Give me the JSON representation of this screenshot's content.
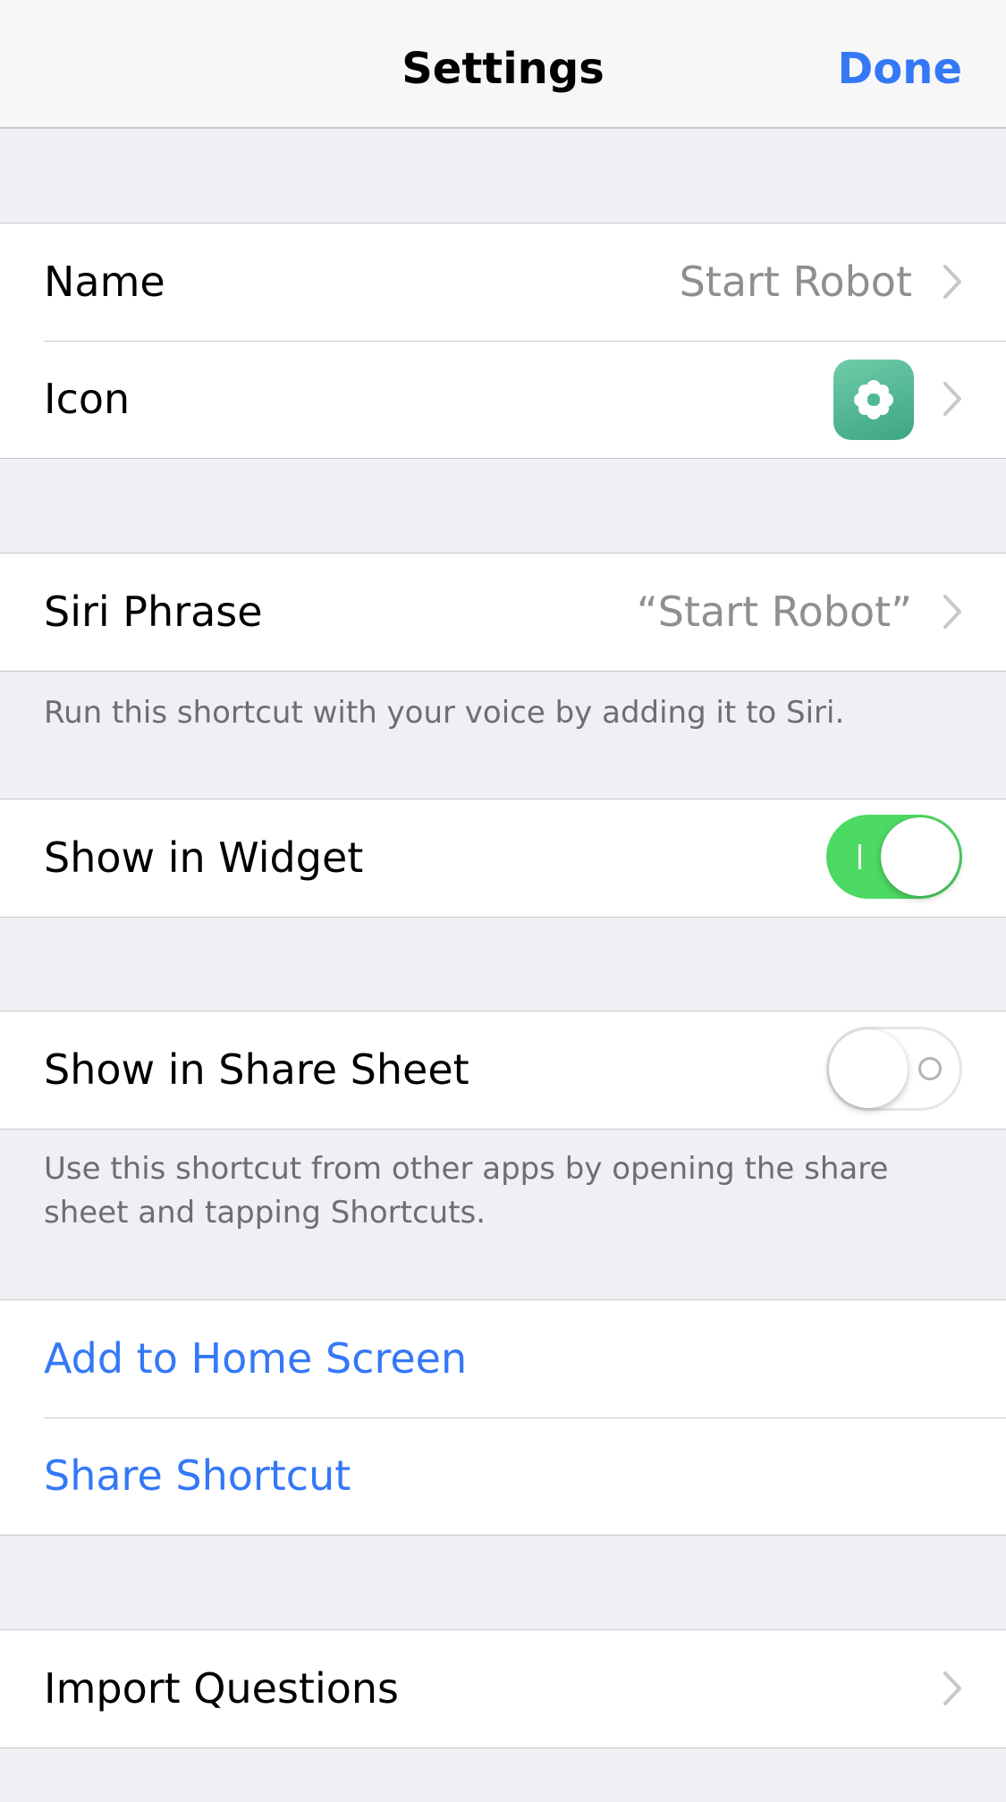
{
  "nav": {
    "title": "Settings",
    "done_label": "Done"
  },
  "group1": {
    "name_label": "Name",
    "name_value": "Start Robot",
    "icon_label": "Icon",
    "icon_name": "flower-icon",
    "icon_colors": [
      "#6fcca8",
      "#3da584"
    ]
  },
  "group2": {
    "siri_label": "Siri Phrase",
    "siri_value": "“Start Robot”",
    "footer": "Run this shortcut with your voice by adding it to Siri."
  },
  "group3": {
    "widget_label": "Show in Widget",
    "widget_on": true
  },
  "group4": {
    "share_sheet_label": "Show in Share Sheet",
    "share_sheet_on": false,
    "footer": "Use this shortcut from other apps by opening the share sheet and tapping Shortcuts."
  },
  "group5": {
    "home_screen_label": "Add to Home Screen",
    "share_label": "Share Shortcut"
  },
  "group6": {
    "import_label": "Import Questions"
  },
  "colors": {
    "accent": "#3478f6",
    "toggle_on": "#4cd964",
    "secondary_text": "#8e8e93",
    "background": "#efeff4"
  }
}
